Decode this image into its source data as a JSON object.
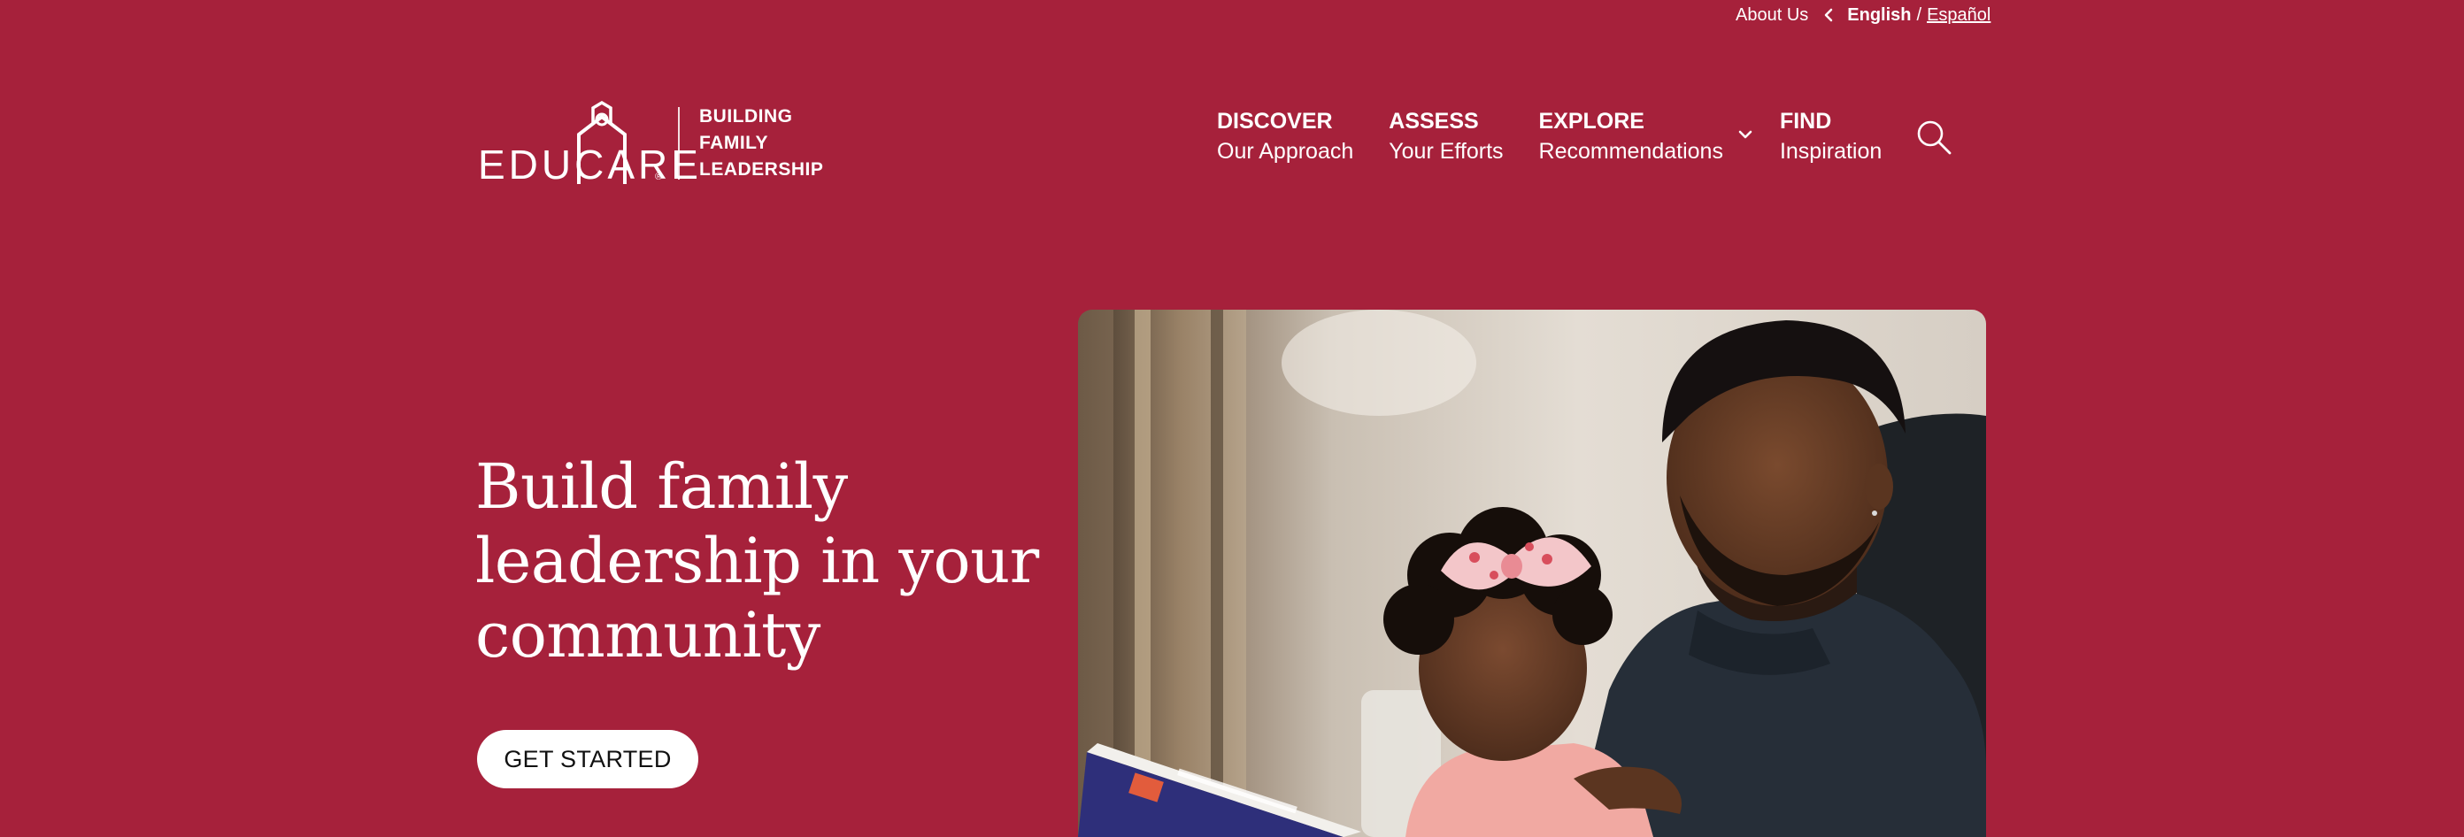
{
  "utility": {
    "about": "About Us",
    "lang_current": "English",
    "lang_separator": "/",
    "lang_alt": "Español"
  },
  "logo": {
    "wordmark": "EDUCARE",
    "registered": "®",
    "tagline": [
      "BUILDING",
      "FAMILY",
      "LEADERSHIP"
    ]
  },
  "nav": {
    "items": [
      {
        "title": "DISCOVER",
        "subtitle": "Our Approach"
      },
      {
        "title": "ASSESS",
        "subtitle": "Your Efforts"
      },
      {
        "title": "EXPLORE",
        "subtitle": "Recommendations"
      },
      {
        "title": "FIND",
        "subtitle": "Inspiration"
      }
    ],
    "search_icon": "search-icon",
    "dropdown_icon": "chevron-down-icon"
  },
  "hero": {
    "heading": "Build family leadership in your community",
    "cta": "GET STARTED",
    "image_subject": "father-and-daughter-reading-photo"
  },
  "colors": {
    "brand": "#a6213b",
    "text": "#ffffff",
    "button_bg": "#ffffff",
    "button_text": "#111111"
  }
}
